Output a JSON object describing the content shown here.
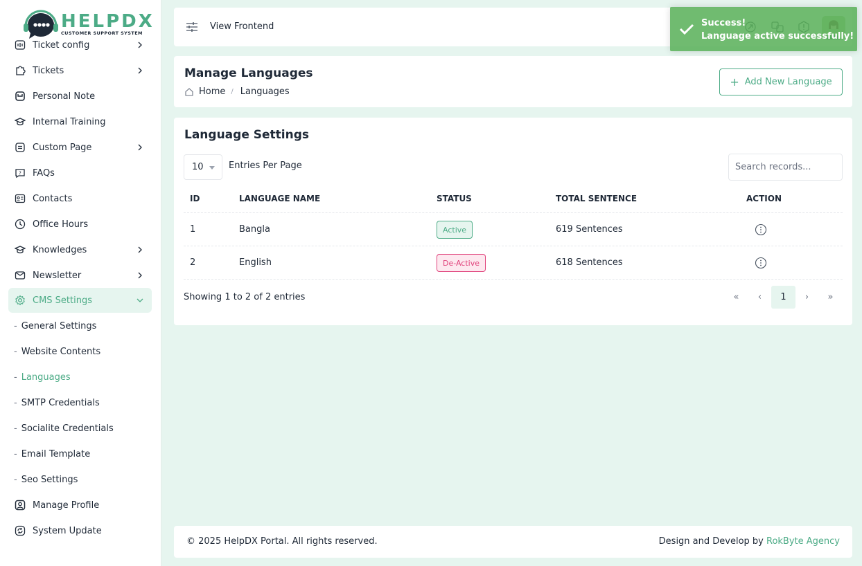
{
  "brand": {
    "name": "HELPDX",
    "tagline": "CUSTOMER SUPPORT SYSTEM"
  },
  "sidebar": {
    "items": [
      {
        "label": "Ticket config",
        "icon": "ticket-config-icon"
      },
      {
        "label": "Tickets",
        "icon": "tickets-icon"
      },
      {
        "label": "Personal Note",
        "icon": "note-icon"
      },
      {
        "label": "Internal Training",
        "icon": "graduation-icon"
      },
      {
        "label": "Custom Page",
        "icon": "page-icon"
      },
      {
        "label": "FAQs",
        "icon": "question-icon"
      },
      {
        "label": "Contacts",
        "icon": "contact-card-icon"
      },
      {
        "label": "Office Hours",
        "icon": "clock-icon"
      },
      {
        "label": "Knowledges",
        "icon": "knowledge-icon"
      },
      {
        "label": "Newsletter",
        "icon": "newsletter-icon"
      },
      {
        "label": "CMS Settings",
        "icon": "gear-icon"
      }
    ],
    "cms_sub": [
      "General Settings",
      "Website Contents",
      "Languages",
      "SMTP Credentials",
      "Socialite Credentials",
      "Email Template",
      "Seo Settings"
    ],
    "bottom": [
      {
        "label": "Manage Profile",
        "icon": "user-icon"
      },
      {
        "label": "System Update",
        "icon": "refresh-icon"
      }
    ]
  },
  "topbar": {
    "view_frontend": "View Frontend"
  },
  "header": {
    "title": "Manage Languages",
    "breadcrumb_home": "Home",
    "breadcrumb_current": "Languages",
    "add_button": "Add New Language"
  },
  "table": {
    "title": "Language Settings",
    "per_page": "10",
    "per_page_label": "Entries Per Page",
    "search_placeholder": "Search records...",
    "headers": [
      "ID",
      "LANGUAGE NAME",
      "STATUS",
      "TOTAL SENTENCE",
      "ACTION"
    ],
    "rows": [
      {
        "id": "1",
        "name": "Bangla",
        "status": "Active",
        "sentences": "619 Sentences"
      },
      {
        "id": "2",
        "name": "English",
        "status": "De-Active",
        "sentences": "618 Sentences"
      }
    ],
    "showing": "Showing 1 to 2 of 2 entries",
    "pagination": [
      "«",
      "‹",
      "1",
      "›",
      "»"
    ]
  },
  "footer": {
    "copyright": "© 2025 HelpDX Portal. All rights reserved.",
    "credit_prefix": "Design and Develop by ",
    "credit_link": "RokByte Agency"
  },
  "toast": {
    "title": "Success!",
    "message": "Language active successfully!"
  },
  "colors": {
    "accent": "#4cab86",
    "danger": "#e0407a",
    "toast": "#58b058",
    "background": "#e6f5ef"
  }
}
